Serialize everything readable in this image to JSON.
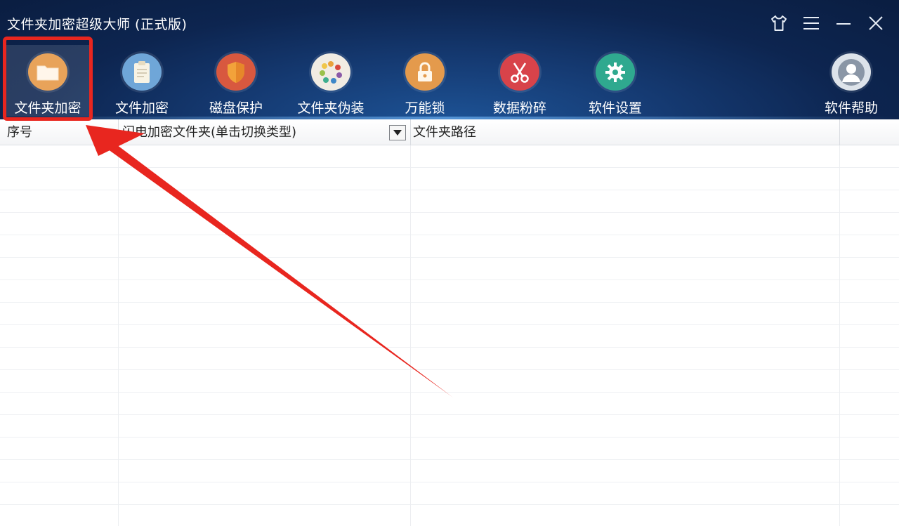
{
  "window": {
    "title": "文件夹加密超级大师 (正式版)"
  },
  "window_controls": {
    "skin_icon": "shirt-icon",
    "menu_icon": "menu-icon",
    "minimize_icon": "minimize-icon",
    "close_icon": "close-icon"
  },
  "toolbar": {
    "items": [
      {
        "label": "文件夹加密",
        "icon": "folder-icon",
        "color": "#e8a35a",
        "active": true
      },
      {
        "label": "文件加密",
        "icon": "clipboard-icon",
        "color": "#6fa6d8"
      },
      {
        "label": "磁盘保护",
        "icon": "shield-icon",
        "color": "#d8583f"
      },
      {
        "label": "文件夹伪装",
        "icon": "palette-icon",
        "color": "#f1ece3"
      },
      {
        "label": "万能锁",
        "icon": "lock-icon",
        "color": "#e49a4c"
      },
      {
        "label": "数据粉碎",
        "icon": "scissors-icon",
        "color": "#d8434a"
      },
      {
        "label": "软件设置",
        "icon": "gear-icon",
        "color": "#2fa98f"
      },
      {
        "label": "软件帮助",
        "icon": "user-icon",
        "color": "#dde3ea"
      }
    ]
  },
  "table": {
    "columns": {
      "index": "序号",
      "folder": "闪电加密文件夹(单击切换类型)",
      "path": "文件夹路径"
    },
    "rows": []
  },
  "annotation": {
    "highlight_color": "#e8261f"
  }
}
